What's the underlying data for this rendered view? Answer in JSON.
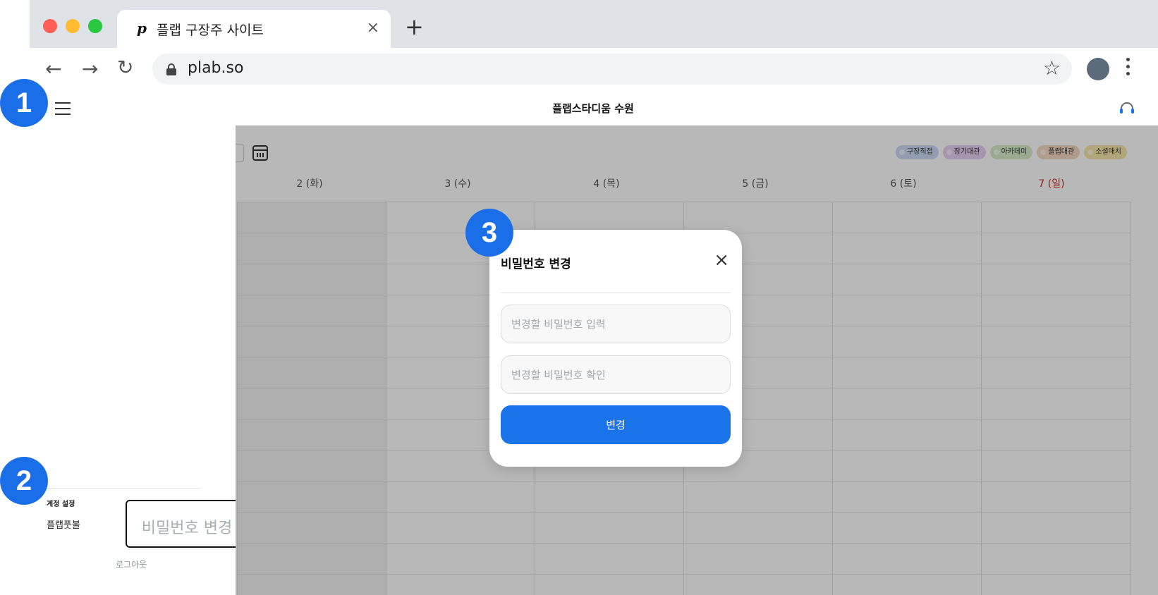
{
  "browser": {
    "tab_title": "플랩 구장주 사이트",
    "tab_favicon": "p",
    "tab_close": "×",
    "new_tab": "+",
    "url": "plab.so",
    "icons": {
      "back": "←",
      "forward": "→",
      "reload": "↻",
      "bookmark": "☆"
    }
  },
  "header": {
    "title": "플랩스타디움 수원"
  },
  "calendar": {
    "legend": [
      {
        "label": "구장직접",
        "color": "#c9daf6"
      },
      {
        "label": "장기대관",
        "color": "#e5cff3"
      },
      {
        "label": "아카데미",
        "color": "#d6eec9"
      },
      {
        "label": "플랩대관",
        "color": "#f6d8c2"
      },
      {
        "label": "소셜매치",
        "color": "#f6e6a8"
      }
    ],
    "days": [
      "2 (화)",
      "3 (수)",
      "4 (목)",
      "5 (금)",
      "6 (토)",
      "7 (일)"
    ]
  },
  "sidebar": {
    "section_label": "계정 설정",
    "user_name": "플랩풋볼",
    "change_password": "비밀번호 변경",
    "logout": "로그아웃"
  },
  "modal": {
    "title": "비밀번호 변경",
    "close": "×",
    "new_password_placeholder": "변경할 비밀번호 입력",
    "confirm_password_placeholder": "변경할 비밀번호 확인",
    "submit_label": "변경"
  },
  "steps": [
    "1",
    "2",
    "3"
  ]
}
